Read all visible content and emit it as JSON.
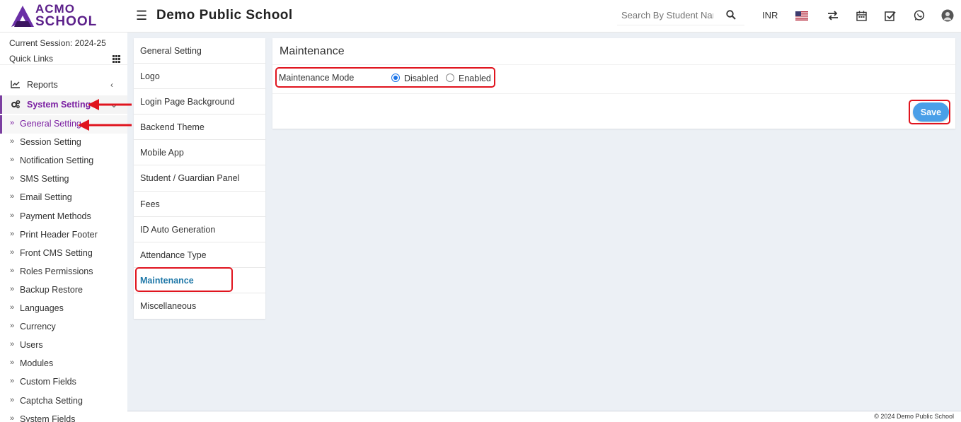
{
  "brand": {
    "logo_top": "ACMO",
    "logo_bottom": "SCHOOL",
    "colors": {
      "primary": "#5b1f8a",
      "accent": "#7b1fa2",
      "link": "#1f78a8",
      "save": "#4a9fe8",
      "highlight": "#e0141e"
    }
  },
  "header": {
    "school_name": "Demo Public School",
    "search_placeholder": "Search By Student Name",
    "currency": "INR",
    "icons": [
      "flag-us-icon",
      "swap-icon",
      "calendar-icon",
      "check-square-icon",
      "whatsapp-icon",
      "user-avatar"
    ]
  },
  "sidebar": {
    "session": "Current Session: 2024-25",
    "quick_links": "Quick Links",
    "reports": "Reports",
    "system_setting": "System Setting",
    "sub_items": [
      "General Setting",
      "Session Setting",
      "Notification Setting",
      "SMS Setting",
      "Email Setting",
      "Payment Methods",
      "Print Header Footer",
      "Front CMS Setting",
      "Roles Permissions",
      "Backup Restore",
      "Languages",
      "Currency",
      "Users",
      "Modules",
      "Custom Fields",
      "Captcha Setting",
      "System Fields"
    ],
    "active_sub": "General Setting"
  },
  "settings_nav": {
    "items": [
      "General Setting",
      "Logo",
      "Login Page Background",
      "Backend Theme",
      "Mobile App",
      "Student / Guardian Panel",
      "Fees",
      "ID Auto Generation",
      "Attendance Type",
      "Maintenance",
      "Miscellaneous"
    ],
    "active": "Maintenance"
  },
  "content": {
    "title": "Maintenance",
    "field_label": "Maintenance Mode",
    "options": [
      "Disabled",
      "Enabled"
    ],
    "selected": "Disabled",
    "save_label": "Save"
  },
  "footer": {
    "text": "© 2024 Demo Public School"
  }
}
